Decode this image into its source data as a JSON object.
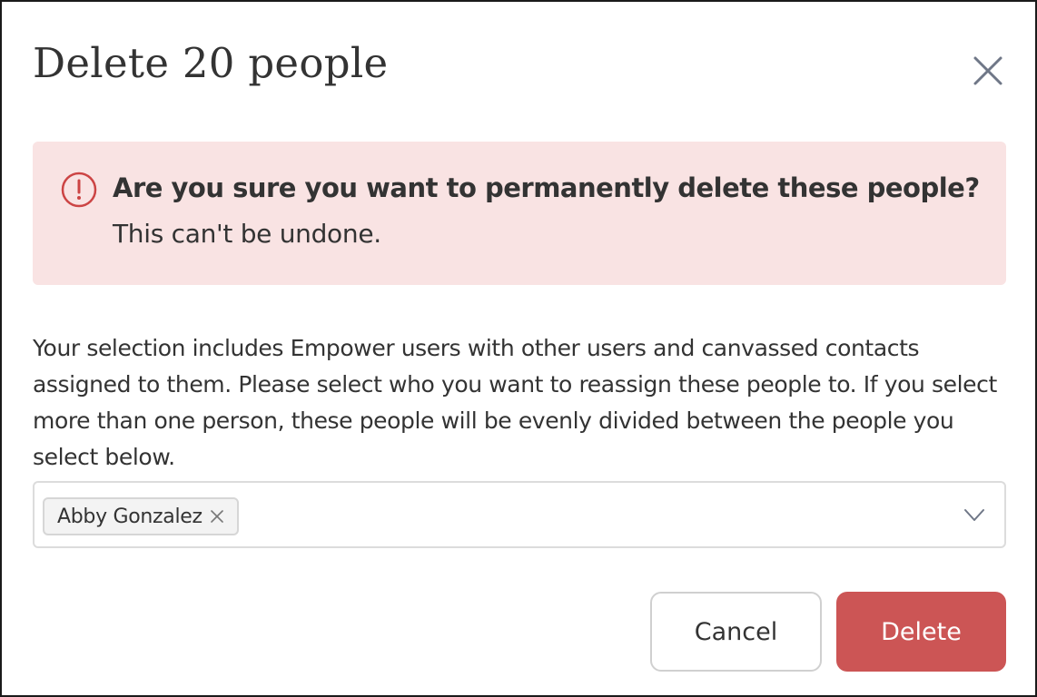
{
  "dialog": {
    "title": "Delete 20 people",
    "close_icon": "close-icon"
  },
  "alert": {
    "icon": "exclamation-circle-icon",
    "heading": "Are you sure you want to permanently delete these people?",
    "subtext": "This can't be undone.",
    "background_color": "#f9e3e3",
    "accent_color": "#cc4444"
  },
  "description": "Your selection includes Empower users with other users and canvassed contacts assigned to them. Please select who you want to reassign these people to. If you select more than one person, these people will be evenly divided between the people you select below.",
  "reassign_select": {
    "selected_tags": [
      {
        "label": "Abby Gonzalez",
        "remove_icon": "close-icon"
      }
    ],
    "dropdown_icon": "chevron-down-icon"
  },
  "actions": {
    "cancel_label": "Cancel",
    "delete_label": "Delete",
    "delete_color": "#cc5555"
  }
}
